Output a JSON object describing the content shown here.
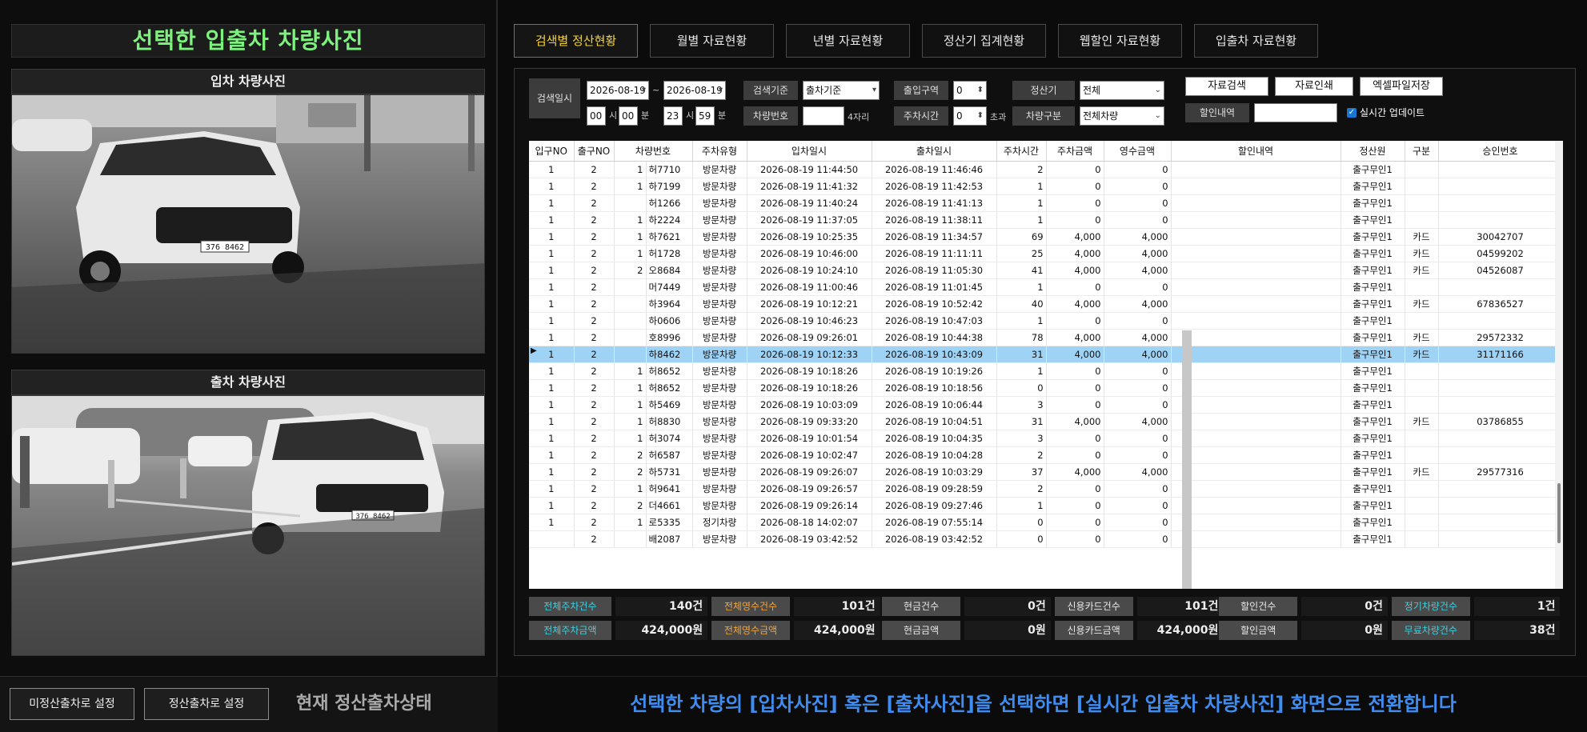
{
  "left": {
    "title": "선택한 입출차 차량사진",
    "entry_label": "입차 차량사진",
    "exit_label": "출차 차량사진",
    "entry_plate": "376 8462",
    "exit_plate": "376 8462",
    "btn_unpaid": "미정산출차로 설정",
    "btn_paid": "정산출차로 설정",
    "state": "현재 정산출차상태"
  },
  "tabs": [
    "검색별 정산현황",
    "월별 자료현황",
    "년별 자료현황",
    "정산기 집계현황",
    "웹할인 자료현황",
    "입출차 자료현황"
  ],
  "filters": {
    "search_date_label": "검색일시",
    "date_from": "2026-08-19",
    "date_tilde": "~",
    "date_to": "2026-08-19",
    "hour_from": "00",
    "min_from": "00",
    "hour_to": "23",
    "min_to": "59",
    "unit_hour": "시",
    "unit_min": "분",
    "criteria_label": "검색기준",
    "criteria_value": "출차기준",
    "plate_label": "차량번호",
    "plate_value": "",
    "plate_hint": "4자리",
    "zone_label": "출입구역",
    "zone_value": "0",
    "park_time_label": "주차시간",
    "park_time_value": "0",
    "park_time_hint": "초과",
    "machine_label": "정산기",
    "machine_value": "전체",
    "vehicle_type_label": "차량구분",
    "vehicle_type_value": "전체차량",
    "discount_label": "할인내역",
    "discount_value": "",
    "btn_search": "자료검색",
    "btn_print": "자료인쇄",
    "btn_excel": "엑셀파일저장",
    "realtime_label": "실시간 업데이트",
    "realtime_checked": true
  },
  "table": {
    "headers": [
      "입구NO",
      "출구NO",
      "차량번호",
      "주차유형",
      "입차일시",
      "출차일시",
      "주차시간",
      "주차금액",
      "영수금액",
      "할인내역",
      "정산원",
      "구분",
      "승인번호"
    ],
    "rows": [
      [
        "1",
        "2",
        "1",
        "허7710",
        "방문차량",
        "2026-08-19 11:44:50",
        "2026-08-19 11:46:46",
        "2",
        "0",
        "0",
        "",
        "출구무인1",
        "",
        ""
      ],
      [
        "1",
        "2",
        "1",
        "하7199",
        "방문차량",
        "2026-08-19 11:41:32",
        "2026-08-19 11:42:53",
        "1",
        "0",
        "0",
        "",
        "출구무인1",
        "",
        ""
      ],
      [
        "1",
        "2",
        "",
        "허1266",
        "방문차량",
        "2026-08-19 11:40:24",
        "2026-08-19 11:41:13",
        "1",
        "0",
        "0",
        "",
        "출구무인1",
        "",
        ""
      ],
      [
        "1",
        "2",
        "1",
        "하2224",
        "방문차량",
        "2026-08-19 11:37:05",
        "2026-08-19 11:38:11",
        "1",
        "0",
        "0",
        "",
        "출구무인1",
        "",
        ""
      ],
      [
        "1",
        "2",
        "1",
        "하7621",
        "방문차량",
        "2026-08-19 10:25:35",
        "2026-08-19 11:34:57",
        "69",
        "4,000",
        "4,000",
        "",
        "출구무인1",
        "카드",
        "30042707"
      ],
      [
        "1",
        "2",
        "1",
        "허1728",
        "방문차량",
        "2026-08-19 10:46:00",
        "2026-08-19 11:11:11",
        "25",
        "4,000",
        "4,000",
        "",
        "출구무인1",
        "카드",
        "04599202"
      ],
      [
        "1",
        "2",
        "2",
        "오8684",
        "방문차량",
        "2026-08-19 10:24:10",
        "2026-08-19 11:05:30",
        "41",
        "4,000",
        "4,000",
        "",
        "출구무인1",
        "카드",
        "04526087"
      ],
      [
        "1",
        "2",
        "",
        "머7449",
        "방문차량",
        "2026-08-19 11:00:46",
        "2026-08-19 11:01:45",
        "1",
        "0",
        "0",
        "",
        "출구무인1",
        "",
        ""
      ],
      [
        "1",
        "2",
        "",
        "하3964",
        "방문차량",
        "2026-08-19 10:12:21",
        "2026-08-19 10:52:42",
        "40",
        "4,000",
        "4,000",
        "",
        "출구무인1",
        "카드",
        "67836527"
      ],
      [
        "1",
        "2",
        "",
        "하0606",
        "방문차량",
        "2026-08-19 10:46:23",
        "2026-08-19 10:47:03",
        "1",
        "0",
        "0",
        "",
        "출구무인1",
        "",
        ""
      ],
      [
        "1",
        "2",
        "",
        "호8996",
        "방문차량",
        "2026-08-19 09:26:01",
        "2026-08-19 10:44:38",
        "78",
        "4,000",
        "4,000",
        "",
        "출구무인1",
        "카드",
        "29572332"
      ],
      [
        "1",
        "2",
        "",
        "하8462",
        "방문차량",
        "2026-08-19 10:12:33",
        "2026-08-19 10:43:09",
        "31",
        "4,000",
        "4,000",
        "",
        "출구무인1",
        "카드",
        "31171166"
      ],
      [
        "1",
        "2",
        "1",
        "허8652",
        "방문차량",
        "2026-08-19 10:18:26",
        "2026-08-19 10:19:26",
        "1",
        "0",
        "0",
        "",
        "출구무인1",
        "",
        ""
      ],
      [
        "1",
        "2",
        "1",
        "허8652",
        "방문차량",
        "2026-08-19 10:18:26",
        "2026-08-19 10:18:56",
        "0",
        "0",
        "0",
        "",
        "출구무인1",
        "",
        ""
      ],
      [
        "1",
        "2",
        "1",
        "하5469",
        "방문차량",
        "2026-08-19 10:03:09",
        "2026-08-19 10:06:44",
        "3",
        "0",
        "0",
        "",
        "출구무인1",
        "",
        ""
      ],
      [
        "1",
        "2",
        "1",
        "허8830",
        "방문차량",
        "2026-08-19 09:33:20",
        "2026-08-19 10:04:51",
        "31",
        "4,000",
        "4,000",
        "",
        "출구무인1",
        "카드",
        "03786855"
      ],
      [
        "1",
        "2",
        "1",
        "허3074",
        "방문차량",
        "2026-08-19 10:01:54",
        "2026-08-19 10:04:35",
        "3",
        "0",
        "0",
        "",
        "출구무인1",
        "",
        ""
      ],
      [
        "1",
        "2",
        "2",
        "허6587",
        "방문차량",
        "2026-08-19 10:02:47",
        "2026-08-19 10:04:28",
        "2",
        "0",
        "0",
        "",
        "출구무인1",
        "",
        ""
      ],
      [
        "1",
        "2",
        "2",
        "하5731",
        "방문차량",
        "2026-08-19 09:26:07",
        "2026-08-19 10:03:29",
        "37",
        "4,000",
        "4,000",
        "",
        "출구무인1",
        "카드",
        "29577316"
      ],
      [
        "1",
        "2",
        "1",
        "허9641",
        "방문차량",
        "2026-08-19 09:26:57",
        "2026-08-19 09:28:59",
        "2",
        "0",
        "0",
        "",
        "출구무인1",
        "",
        ""
      ],
      [
        "1",
        "2",
        "2",
        "더4661",
        "방문차량",
        "2026-08-19 09:26:14",
        "2026-08-19 09:27:46",
        "1",
        "0",
        "0",
        "",
        "출구무인1",
        "",
        ""
      ],
      [
        "1",
        "2",
        "1",
        "로5335",
        "정기차량",
        "2026-08-18 14:02:07",
        "2026-08-19 07:55:14",
        "0",
        "0",
        "0",
        "",
        "출구무인1",
        "",
        ""
      ],
      [
        "",
        "2",
        "",
        "배2087",
        "방문차량",
        "2026-08-19 03:42:52",
        "2026-08-19 03:42:52",
        "0",
        "0",
        "0",
        "",
        "출구무인1",
        "",
        ""
      ]
    ],
    "selected_index": 11
  },
  "summary": [
    [
      {
        "label": "전체주차건수",
        "value": "140건",
        "color": "#3fd0e0"
      },
      {
        "label": "전체영수건수",
        "value": "101건",
        "color": "#f2a43a"
      },
      {
        "label": "현금건수",
        "value": "0건",
        "color": "#e8e8e8"
      },
      {
        "label": "신용카드건수",
        "value": "101건",
        "color": "#e8e8e8"
      },
      {
        "label": "할인건수",
        "value": "0건",
        "color": "#e8e8e8"
      },
      {
        "label": "정기차량건수",
        "value": "1건",
        "color": "#3fd0e0"
      }
    ],
    [
      {
        "label": "전체주차금액",
        "value": "424,000원",
        "color": "#3fd0e0"
      },
      {
        "label": "전체영수금액",
        "value": "424,000원",
        "color": "#f2a43a"
      },
      {
        "label": "현금금액",
        "value": "0원",
        "color": "#e8e8e8"
      },
      {
        "label": "신용카드금액",
        "value": "424,000원",
        "color": "#e8e8e8"
      },
      {
        "label": "할인금액",
        "value": "0원",
        "color": "#e8e8e8"
      },
      {
        "label": "무료차량건수",
        "value": "38건",
        "color": "#3fd0e0"
      }
    ]
  ],
  "notice": "선택한 차량의 [입차사진] 혹은 [출차사진]을 선택하면 [실시간 입출차 차량사진] 화면으로 전환합니다"
}
